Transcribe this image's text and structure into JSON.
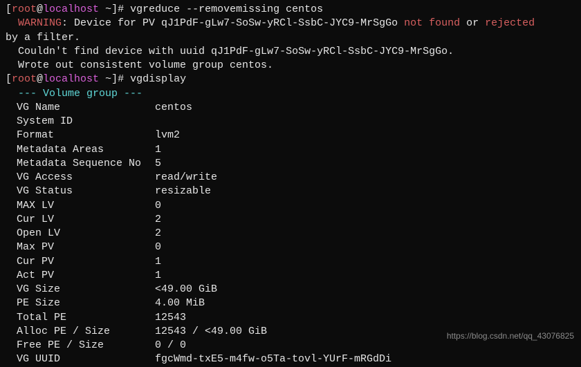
{
  "prompt1": {
    "user": "root",
    "host": "localhost",
    "path": "~",
    "cmd": "vgreduce --removemissing centos"
  },
  "warning": {
    "label": "WARNING",
    "msg1a": ": Device for PV qJ1PdF-gLw7-SoSw-yRCl-SsbC-JYC9-MrSgGo ",
    "notfound": "not found",
    "or": " or ",
    "rejected": "rejected",
    "msg2": "by a filter.",
    "msg3": "  Couldn't find device with uuid qJ1PdF-gLw7-SoSw-yRCl-SsbC-JYC9-MrSgGo.",
    "msg4": "  Wrote out consistent volume group centos."
  },
  "prompt2": {
    "user": "root",
    "host": "localhost",
    "path": "~",
    "cmd": "vgdisplay"
  },
  "vgheader": "  --- Volume group ---",
  "vg": {
    "name_k": "VG Name",
    "name_v": "centos",
    "sysid_k": "System ID",
    "sysid_v": "",
    "format_k": "Format",
    "format_v": "lvm2",
    "mdareas_k": "Metadata Areas",
    "mdareas_v": "1",
    "mdseq_k": "Metadata Sequence No",
    "mdseq_v": "5",
    "access_k": "VG Access",
    "access_v": "read/write",
    "status_k": "VG Status",
    "status_v": "resizable",
    "maxlv_k": "MAX LV",
    "maxlv_v": "0",
    "curlv_k": "Cur LV",
    "curlv_v": "2",
    "openlv_k": "Open LV",
    "openlv_v": "2",
    "maxpv_k": "Max PV",
    "maxpv_v": "0",
    "curpv_k": "Cur PV",
    "curpv_v": "1",
    "actpv_k": "Act PV",
    "actpv_v": "1",
    "vgsize_k": "VG Size",
    "vgsize_v": "<49.00 GiB",
    "pesize_k": "PE Size",
    "pesize_v": "4.00 MiB",
    "totalpe_k": "Total PE",
    "totalpe_v": "12543",
    "allocpe_k": "Alloc PE / Size",
    "allocpe_v": "12543 / <49.00 GiB",
    "freepe_k": "Free  PE / Size",
    "freepe_v": "0 / 0",
    "uuid_k": "VG UUID",
    "uuid_v": "fgcWmd-txE5-m4fw-o5Ta-tovl-YUrF-mRGdDi"
  },
  "watermark": "https://blog.csdn.net/qq_43076825"
}
